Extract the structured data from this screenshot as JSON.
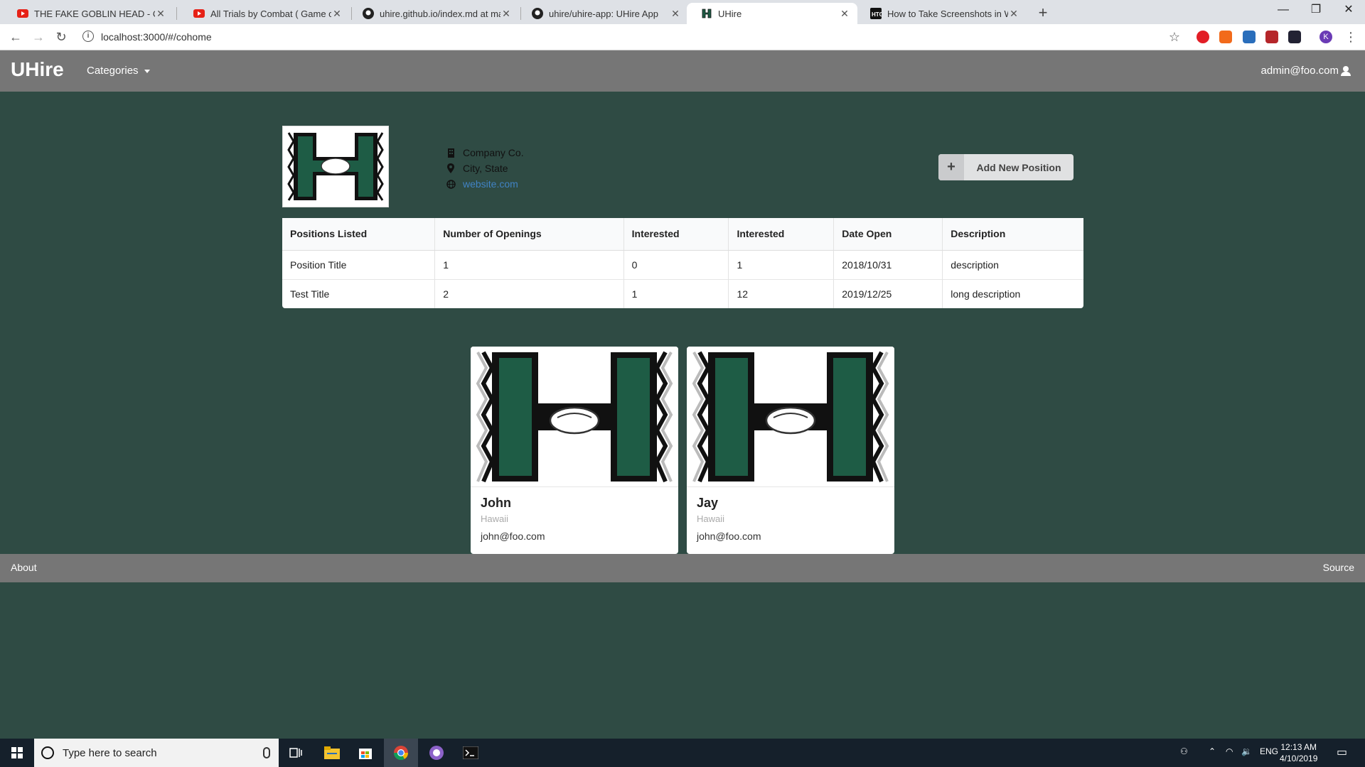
{
  "browser": {
    "tabs": [
      {
        "title": "THE FAKE GOBLIN HEAD - OFFLINE",
        "icon": "youtube-icon"
      },
      {
        "title": "All Trials by Combat ( Game of Thrones )",
        "icon": "youtube-icon"
      },
      {
        "title": "uhire.github.io/index.md at master",
        "icon": "github-icon"
      },
      {
        "title": "uhire/uhire-app: UHire App",
        "icon": "github-icon"
      },
      {
        "title": "UHire",
        "icon": "uhire-icon",
        "active": true
      },
      {
        "title": "How to Take Screenshots in Windows",
        "icon": "htg-icon"
      }
    ],
    "url": "localhost:3000/#/cohome",
    "profile_initial": "K"
  },
  "navbar": {
    "brand": "UHire",
    "categories": "Categories",
    "user": "admin@foo.com"
  },
  "company": {
    "name": "Company Co.",
    "location": "City, State",
    "website": "website.com"
  },
  "add_position_label": "Add New Position",
  "table": {
    "headers": [
      "Positions Listed",
      "Number of Openings",
      "Interested",
      "Interested",
      "Date Open",
      "Description"
    ],
    "rows": [
      [
        "Position Title",
        "1",
        "0",
        "1",
        "2018/10/31",
        "description"
      ],
      [
        "Test Title",
        "2",
        "1",
        "12",
        "2019/12/25",
        "long description"
      ]
    ]
  },
  "cards": [
    {
      "name": "John",
      "location": "Hawaii",
      "email": "john@foo.com"
    },
    {
      "name": "Jay",
      "location": "Hawaii",
      "email": "john@foo.com"
    }
  ],
  "footer": {
    "about": "About",
    "source": "Source"
  },
  "taskbar": {
    "search_placeholder": "Type here to search",
    "language": "ENG",
    "time": "12:13 AM",
    "date": "4/10/2019"
  },
  "colors": {
    "page_bg": "#2f4b44",
    "navbar_bg": "#767676",
    "logo_green": "#1e5c45"
  }
}
